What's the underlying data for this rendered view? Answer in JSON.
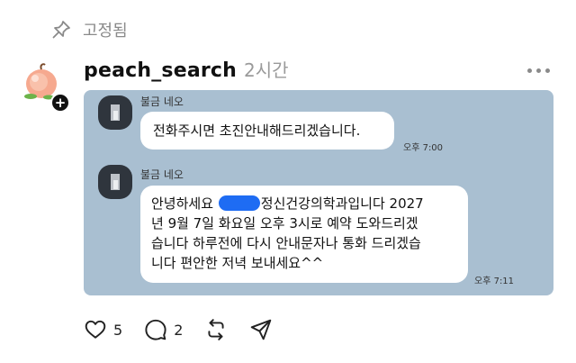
{
  "pinned": {
    "label": "고정됨",
    "icon": "pin-icon"
  },
  "post": {
    "username": "peach_search",
    "time": "2시간",
    "avatar_icon": "peach-avatar-icon",
    "follow_icon": "plus-icon"
  },
  "chat": {
    "background": "#a9bfd1",
    "messages": [
      {
        "sender": "불금 네오",
        "text": "전화주시면 초진안내해드리겠습니다.",
        "time": "오후 7:00"
      },
      {
        "sender": "불금 네오",
        "line1_pre": "안녕하세요 ",
        "line1_post": "정신건강의학과입니다 2027",
        "line2": "년 9월 7일 화요일 오후 3시로 예약 도와드리겠",
        "line3": "습니다 하루전에 다시 안내문자나 통화 드리겠습",
        "line4": "니다 편안한 저녁 보내세요^^",
        "time": "오후 7:11"
      }
    ]
  },
  "actions": {
    "like_count": "5",
    "reply_count": "2",
    "like_icon": "heart-icon",
    "reply_icon": "comment-icon",
    "repost_icon": "repost-icon",
    "share_icon": "send-icon"
  }
}
